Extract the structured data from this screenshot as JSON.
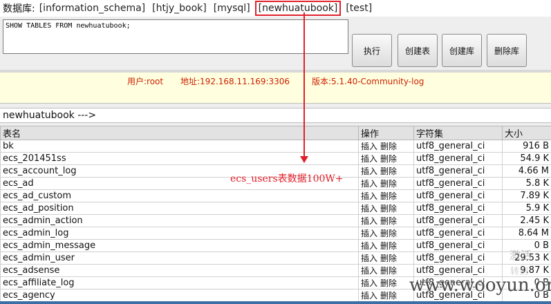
{
  "dbbar": {
    "label": "数据库:",
    "databases": [
      "[information_schema]",
      "[htjy_book]",
      "[mysql]",
      "[newhuatubook]",
      "[test]"
    ],
    "active": "[newhuatubook]"
  },
  "query": {
    "sql": "SHOW TABLES FROM newhuatubook;"
  },
  "buttons": {
    "execute": "执行",
    "create_table": "创建表",
    "create_db": "创建库",
    "drop_db": "删除库"
  },
  "info": {
    "user": "用户:root",
    "address": "地址:192.168.11.169:3306",
    "version": "版本:5.1.40-Community-log"
  },
  "breadcrumb": "newhuatubook --->",
  "table": {
    "headers": {
      "name": "表名",
      "ops": "操作",
      "charset": "字符集",
      "size": "大小"
    },
    "ops": {
      "insert": "插入",
      "delete": "删除"
    },
    "rows": [
      {
        "name": "bk",
        "charset": "utf8_general_ci",
        "size": "916 B"
      },
      {
        "name": "ecs_201451ss",
        "charset": "utf8_general_ci",
        "size": "54.9 K"
      },
      {
        "name": "ecs_account_log",
        "charset": "utf8_general_ci",
        "size": "4.66 M"
      },
      {
        "name": "ecs_ad",
        "charset": "utf8_general_ci",
        "size": "5.8 K"
      },
      {
        "name": "ecs_ad_custom",
        "charset": "utf8_general_ci",
        "size": "7.89 K"
      },
      {
        "name": "ecs_ad_position",
        "charset": "utf8_general_ci",
        "size": "5.9 K"
      },
      {
        "name": "ecs_admin_action",
        "charset": "utf8_general_ci",
        "size": "2.45 K"
      },
      {
        "name": "ecs_admin_log",
        "charset": "utf8_general_ci",
        "size": "8.64 M"
      },
      {
        "name": "ecs_admin_message",
        "charset": "utf8_general_ci",
        "size": "0 B"
      },
      {
        "name": "ecs_admin_user",
        "charset": "utf8_general_ci",
        "size": "29.53 K"
      },
      {
        "name": "ecs_adsense",
        "charset": "utf8_general_ci",
        "size": "9.87 K"
      },
      {
        "name": "ecs_affiliate_log",
        "charset": "utf8_general_ci",
        "size": "0 B"
      },
      {
        "name": "ecs_agency",
        "charset": "utf8_general_ci",
        "size": "0 B"
      }
    ]
  },
  "annotation": "ecs_users表数据100W+",
  "watermark": {
    "line1": "激活",
    "line2": "转到",
    "site": "www.wooyun.org"
  },
  "colors": {
    "annotation": "#e0202a",
    "info_bg": "#ffffe0",
    "info_text": "#cc2200"
  }
}
